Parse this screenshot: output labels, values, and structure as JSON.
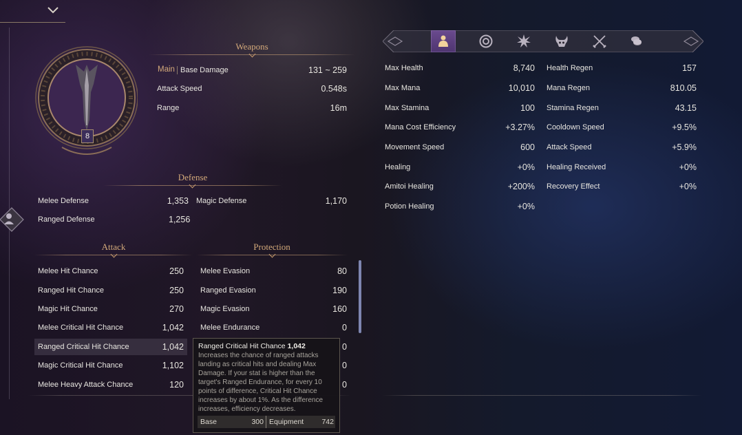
{
  "colors": {
    "accent_gold": "#d3a97a",
    "active_tab": "#5a3d80",
    "main_label": "#d3a97a"
  },
  "top_dropdown": {
    "icon": "chevron-down-icon"
  },
  "side_button": {
    "icon": "character-silhouette-icon"
  },
  "weapon_badge": {
    "level": "8"
  },
  "weapons": {
    "title": "Weapons",
    "main_label": "Main",
    "rows": [
      {
        "label": "Base Damage",
        "value": "131 ~ 259"
      },
      {
        "label": "Attack Speed",
        "value": "0.548s"
      },
      {
        "label": "Range",
        "value": "16m"
      }
    ]
  },
  "defense": {
    "title": "Defense",
    "rows": [
      {
        "label": "Melee Defense",
        "value": "1,353",
        "label2": "Magic Defense",
        "value2": "1,170"
      },
      {
        "label": "Ranged Defense",
        "value": "1,256"
      }
    ]
  },
  "attack": {
    "title": "Attack",
    "rows": [
      {
        "label": "Melee Hit Chance",
        "value": "250"
      },
      {
        "label": "Ranged Hit Chance",
        "value": "250"
      },
      {
        "label": "Magic Hit Chance",
        "value": "270"
      },
      {
        "label": "Melee Critical Hit Chance",
        "value": "1,042"
      },
      {
        "label": "Ranged Critical Hit Chance",
        "value": "1,042"
      },
      {
        "label": "Magic Critical Hit Chance",
        "value": "1,102"
      },
      {
        "label": "Melee Heavy Attack Chance",
        "value": "120"
      }
    ]
  },
  "protection": {
    "title": "Protection",
    "rows": [
      {
        "label": "Melee Evasion",
        "value": "80"
      },
      {
        "label": "Ranged Evasion",
        "value": "190"
      },
      {
        "label": "Magic Evasion",
        "value": "160"
      },
      {
        "label": "Melee Endurance",
        "value": "0"
      },
      {
        "label": "",
        "value": "0"
      },
      {
        "label": "",
        "value": "0"
      },
      {
        "label": "",
        "value": "0"
      }
    ]
  },
  "tooltip": {
    "title": "Ranged Critical Hit Chance",
    "title_value": "1,042",
    "body": "Increases the chance of ranged attacks landing as critical hits and dealing Max Damage. If your stat is higher than the target's Ranged Endurance, for every 10 points of difference, Critical Hit Chance increases by about 1%. As the difference increases, efficiency decreases.",
    "base_label": "Base",
    "base_value": "300",
    "equip_label": "Equipment",
    "equip_value": "742"
  },
  "tabs": [
    {
      "icon": "character-stats-icon",
      "active": true
    },
    {
      "icon": "target-ring-icon",
      "active": false
    },
    {
      "icon": "burst-emblem-icon",
      "active": false
    },
    {
      "icon": "horned-mask-icon",
      "active": false
    },
    {
      "icon": "crossed-swords-icon",
      "active": false
    },
    {
      "icon": "coins-icon",
      "active": false
    }
  ],
  "stats": {
    "left": [
      {
        "label": "Max Health",
        "value": "8,740"
      },
      {
        "label": "Max Mana",
        "value": "10,010"
      },
      {
        "label": "Max Stamina",
        "value": "100"
      },
      {
        "label": "Mana Cost Efficiency",
        "value": "+3.27%"
      },
      {
        "label": "Movement Speed",
        "value": "600"
      },
      {
        "label": "Healing",
        "value": "+0%"
      },
      {
        "label": "Amitoi Healing",
        "value": "+200%"
      },
      {
        "label": "Potion Healing",
        "value": "+0%"
      }
    ],
    "right": [
      {
        "label": "Health Regen",
        "value": "157"
      },
      {
        "label": "Mana Regen",
        "value": "810.05"
      },
      {
        "label": "Stamina Regen",
        "value": "43.15"
      },
      {
        "label": "Cooldown Speed",
        "value": "+9.5%"
      },
      {
        "label": "Attack Speed",
        "value": "+5.9%"
      },
      {
        "label": "Healing Received",
        "value": "+0%"
      },
      {
        "label": "Recovery Effect",
        "value": "+0%"
      }
    ]
  }
}
